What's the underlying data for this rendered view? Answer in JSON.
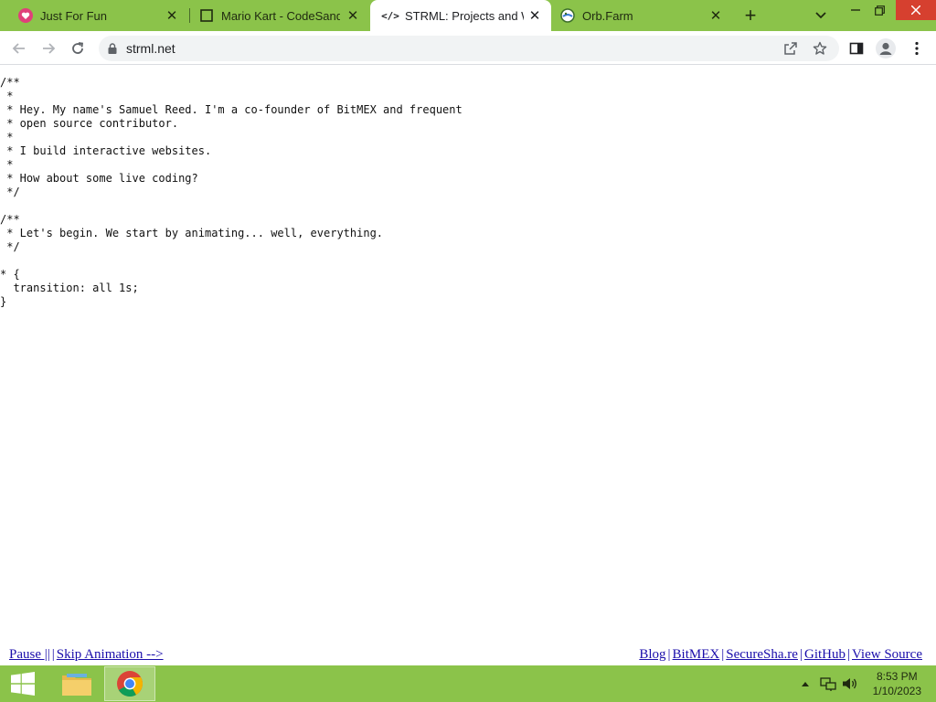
{
  "browser": {
    "tabs": [
      {
        "title": "Just For Fun",
        "icon": "heart-favicon-icon",
        "active": false
      },
      {
        "title": "Mario Kart - CodeSandbox",
        "icon": "codesandbox-favicon-icon",
        "active": false
      },
      {
        "title": "STRML: Projects and Work",
        "icon": "code-favicon-icon",
        "active": true
      },
      {
        "title": "Orb.Farm",
        "icon": "orb-favicon-icon",
        "active": false
      }
    ],
    "new_tab_label": "+",
    "url": "strml.net",
    "window_controls": [
      "minimize",
      "restore",
      "close"
    ]
  },
  "page": {
    "code_text": "/**\n *\n * Hey. My name's Samuel Reed. I'm a co-founder of BitMEX and frequent\n * open source contributor.\n *\n * I build interactive websites.\n *\n * How about some live coding?\n */\n\n/**\n * Let's begin. We start by animating... well, everything.\n */\n\n* {\n  transition: all 1s;\n}",
    "footer_left": {
      "pause": "Pause ||",
      "skip": "Skip Animation -->"
    },
    "footer_right": [
      "Blog",
      "BitMEX",
      "SecureSha.re",
      "GitHub",
      "View Source"
    ],
    "separator": "|"
  },
  "taskbar": {
    "time": "8:53 PM",
    "date": "1/10/2023",
    "apps": [
      "file-explorer-icon",
      "chrome-icon"
    ]
  },
  "colors": {
    "theme_green": "#8bc34a",
    "link_blue": "#1a0dab",
    "close_red": "#d6402f"
  }
}
